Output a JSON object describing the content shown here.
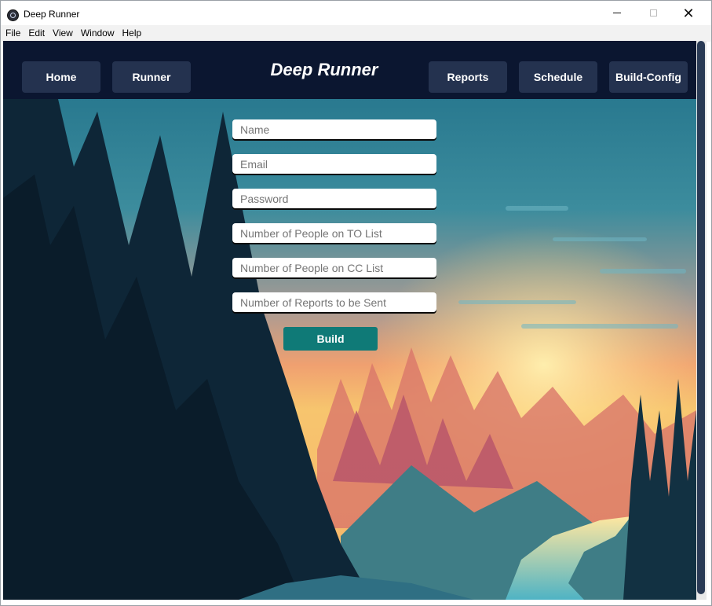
{
  "window": {
    "title": "Deep Runner",
    "close_glyph": "✕"
  },
  "menu": [
    "File",
    "Edit",
    "View",
    "Window",
    "Help"
  ],
  "nav": {
    "brand": "Deep Runner",
    "left_buttons": [
      "Home",
      "Runner"
    ],
    "right_buttons": [
      "Reports",
      "Schedule",
      "Build-Config"
    ]
  },
  "form": {
    "name_placeholder": "Name",
    "email_placeholder": "Email",
    "password_placeholder": "Password",
    "to_placeholder": "Number of People on TO List",
    "cc_placeholder": "Number of People on CC List",
    "reports_placeholder": "Number of Reports to be Sent",
    "build_label": "Build"
  },
  "colors": {
    "navbar": "#0b1630",
    "nav_button": "#24324f",
    "build_button": "#0f7a77"
  }
}
